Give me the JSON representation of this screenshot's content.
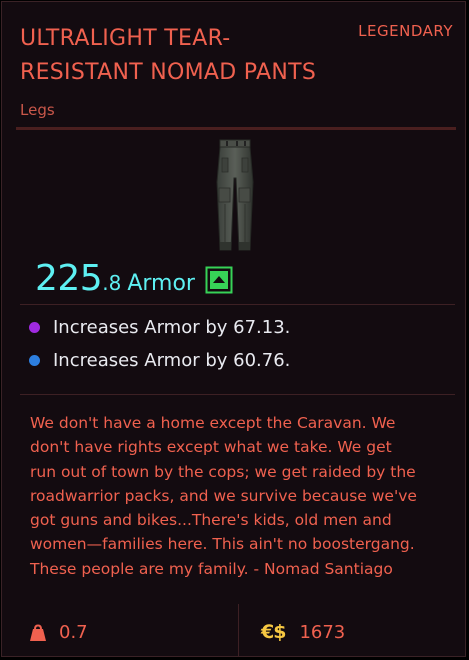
{
  "item": {
    "name": "ULTRALIGHT TEAR-\nRESISTANT NOMAD PANTS",
    "rarity": "LEGENDARY",
    "slot": "Legs",
    "image_icon": "pants-icon",
    "armor": {
      "value_int": "225",
      "value_frac": ".8",
      "label": "Armor",
      "comparison_icon": "upgrade-arrow-icon"
    },
    "stats": [
      {
        "text": "Increases Armor by 67.13.",
        "dot_color": "#a02ae0"
      },
      {
        "text": "Increases Armor by 60.76.",
        "dot_color": "#2d7fe0"
      }
    ],
    "lore": "We don't have a home except the Caravan. We\ndon't have rights except what we take. We get\nrun out of town by the cops; we get raided by the\nroadwarrior packs, and we survive because we've\ngot guns and bikes...There's kids, old men and\nwomen—families here. This ain't no boostergang.\nThese people are my family. - Nomad Santiago",
    "weight": {
      "icon": "weight-icon",
      "value": "0.7"
    },
    "price": {
      "icon": "€$",
      "value": "1673"
    }
  },
  "colors": {
    "panel_bg": "#130b10",
    "title": "#f0614f",
    "slot": "#c9574a",
    "armor": "#5ef0f2",
    "upgrade": "#37d357",
    "stat_text": "#e9eaf0",
    "lore": "#f0614f",
    "weight": "#f0614f",
    "price_symbol": "#f7c842",
    "price_value": "#f0614f"
  }
}
